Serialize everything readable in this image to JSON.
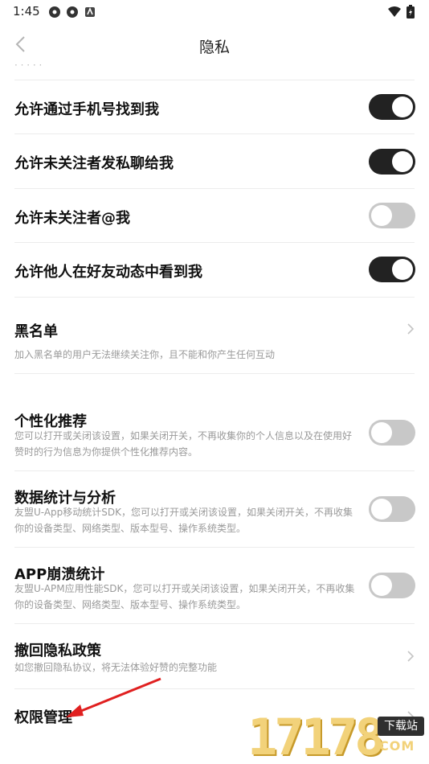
{
  "status_bar": {
    "time": "1:45",
    "left_icons": [
      "app-icon-1",
      "app-icon-2",
      "notification-icon"
    ],
    "right_icons": [
      "wifi-icon",
      "battery-icon"
    ]
  },
  "header": {
    "title": "隐私",
    "back_icon": "chevron-left-icon"
  },
  "settings": {
    "find_by_phone": {
      "label": "允许通过手机号找到我",
      "enabled": true
    },
    "strangers_message": {
      "label": "允许未关注者发私聊给我",
      "enabled": true
    },
    "strangers_mention": {
      "label": "允许未关注者@我",
      "enabled": false
    },
    "friends_feed": {
      "label": "允许他人在好友动态中看到我",
      "enabled": true
    },
    "blacklist": {
      "label": "黑名单",
      "desc": "加入黑名单的用户无法继续关注你，且不能和你产生任何互动"
    },
    "personalized": {
      "label": "个性化推荐",
      "desc": "您可以打开或关闭该设置，如果关闭开关，不再收集你的个人信息以及在使用好赞时的行为信息为你提供个性化推荐内容。",
      "enabled": false
    },
    "analytics": {
      "label": "数据统计与分析",
      "desc": "友盟U-App移动统计SDK，您可以打开或关闭该设置，如果关闭开关，不再收集你的设备类型、网络类型、版本型号、操作系统类型。",
      "enabled": false
    },
    "crash": {
      "label": "APP崩溃统计",
      "desc": "友盟U-APM应用性能SDK，您可以打开或关闭该设置，如果关闭开关，不再收集你的设备类型、网络类型、版本型号、操作系统类型。",
      "enabled": false
    },
    "revoke": {
      "label": "撤回隐私政策",
      "desc": "如您撤回隐私协议，将无法体验好赞的完整功能"
    },
    "permissions": {
      "label": "权限管理"
    }
  },
  "watermark": {
    "digits": "17178",
    "badge": "下载站",
    "domain": "COM"
  },
  "colors": {
    "toggle_on": "#222222",
    "toggle_off": "#c8c8c8",
    "annotation_arrow": "#e02020"
  }
}
